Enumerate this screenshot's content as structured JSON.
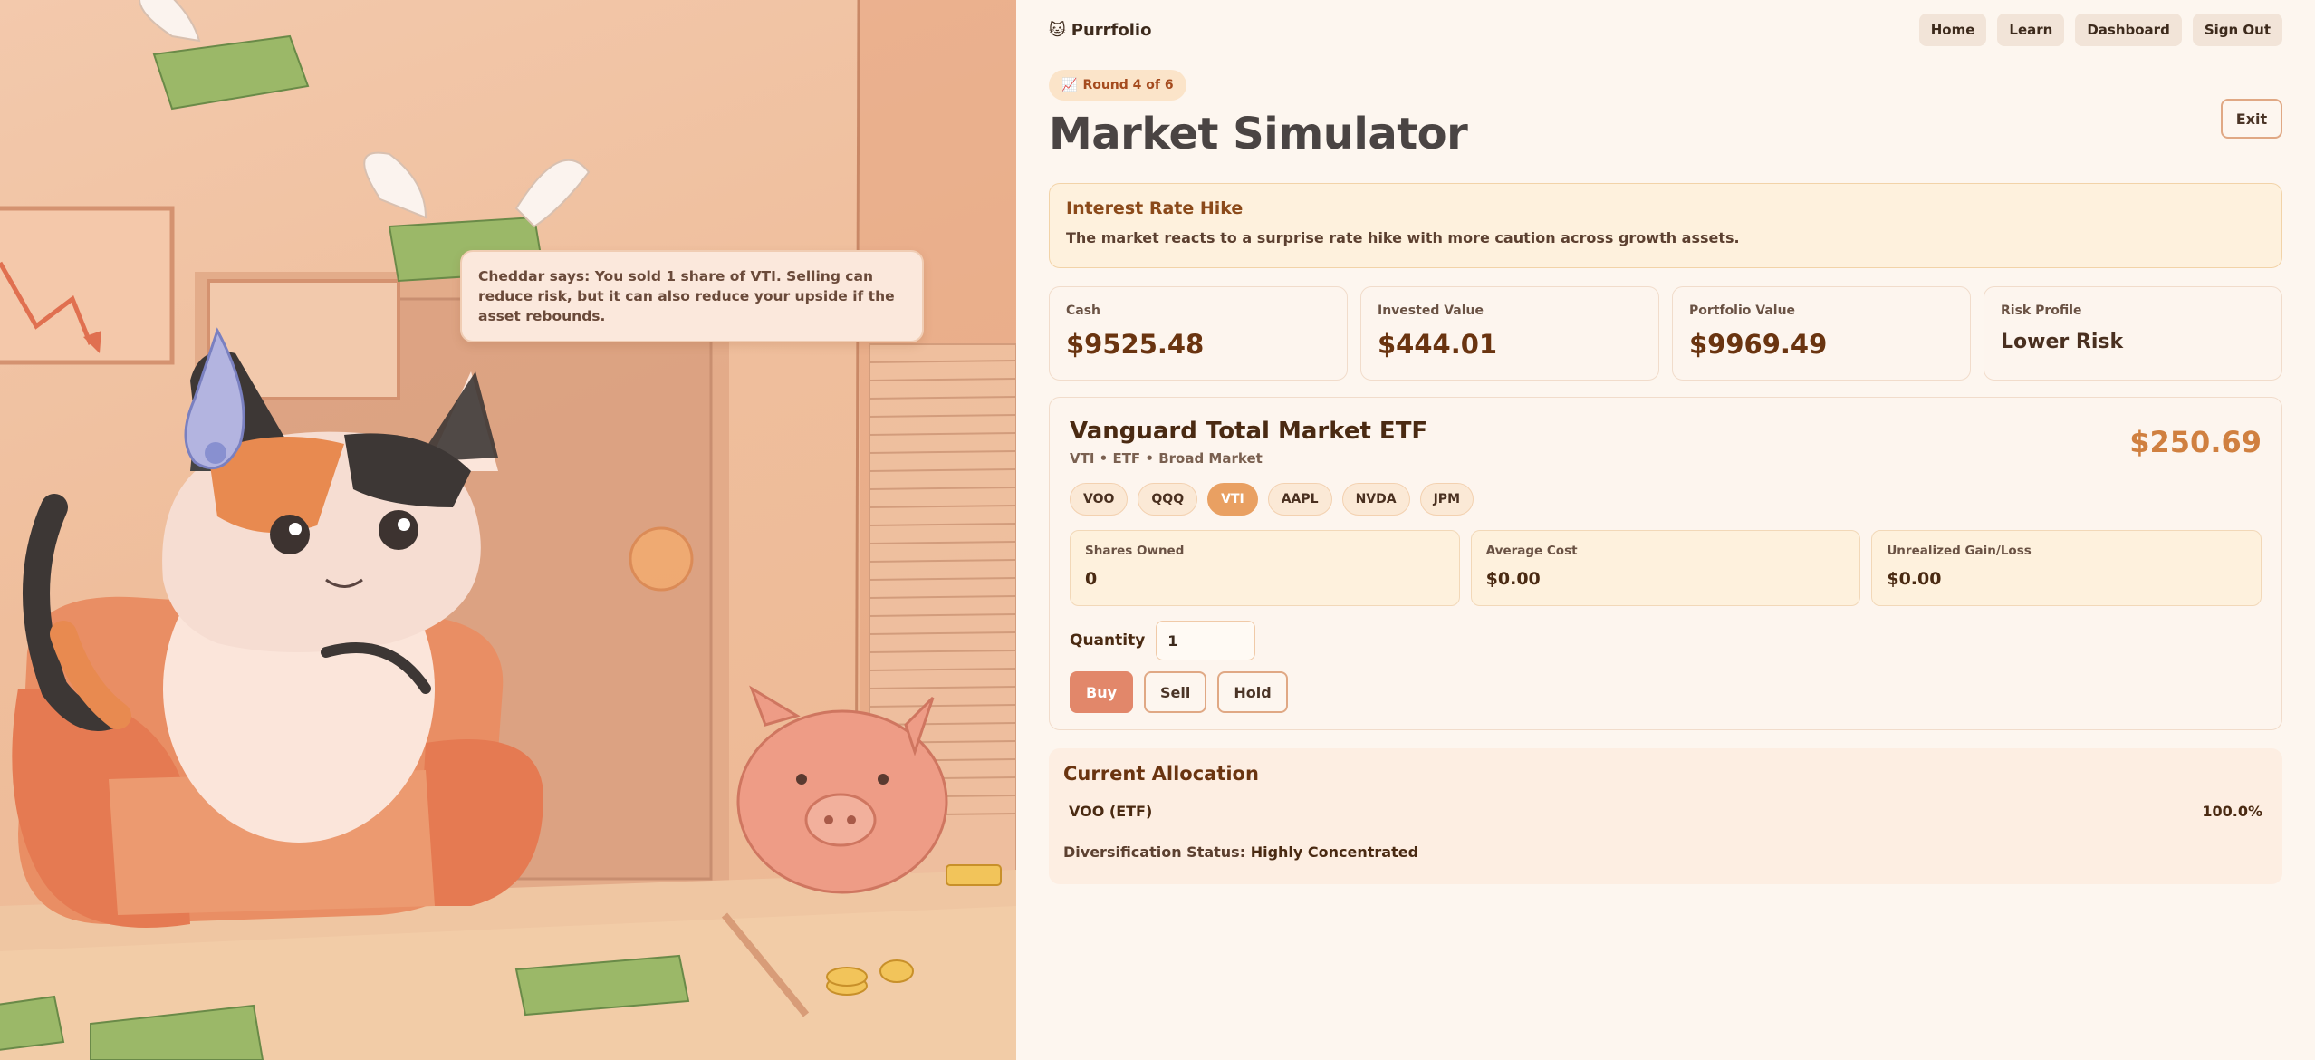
{
  "speech": "Cheddar says: You sold 1 share of VTI. Selling can reduce risk, but it can also reduce your upside if the asset rebounds.",
  "nav": {
    "brand": "Purrfolio",
    "brand_icon": "cat-face-icon",
    "links": [
      "Home",
      "Learn",
      "Dashboard",
      "Sign Out"
    ]
  },
  "round": {
    "label": "Round 4 of 6",
    "icon": "chart-up-icon"
  },
  "exit_label": "Exit",
  "title": "Market Simulator",
  "event": {
    "title": "Interest Rate Hike",
    "description": "The market reacts to a surprise rate hike with more caution across growth assets."
  },
  "stats": [
    {
      "label": "Cash",
      "value": "$9525.48"
    },
    {
      "label": "Invested Value",
      "value": "$444.01"
    },
    {
      "label": "Portfolio Value",
      "value": "$9969.49"
    },
    {
      "label": "Risk Profile",
      "value": "Lower Risk"
    }
  ],
  "asset": {
    "name": "Vanguard Total Market ETF",
    "meta": "VTI • ETF • Broad Market",
    "price": "$250.69",
    "tickers": [
      "VOO",
      "QQQ",
      "VTI",
      "AAPL",
      "NVDA",
      "JPM"
    ],
    "selected_ticker": "VTI",
    "holdings": [
      {
        "label": "Shares Owned",
        "value": "0"
      },
      {
        "label": "Average Cost",
        "value": "$0.00"
      },
      {
        "label": "Unrealized Gain/Loss",
        "value": "$0.00"
      }
    ],
    "quantity_label": "Quantity",
    "quantity_value": "1",
    "actions": {
      "buy": "Buy",
      "sell": "Sell",
      "hold": "Hold"
    }
  },
  "allocation": {
    "title": "Current Allocation",
    "rows": [
      {
        "name": "VOO (ETF)",
        "percent": "100.0%"
      }
    ],
    "status_label": "Diversification Status:",
    "status_value": "Highly Concentrated"
  },
  "colors": {
    "accent": "#e2876a",
    "ticker_active": "#e9a062",
    "price": "#d08040"
  }
}
